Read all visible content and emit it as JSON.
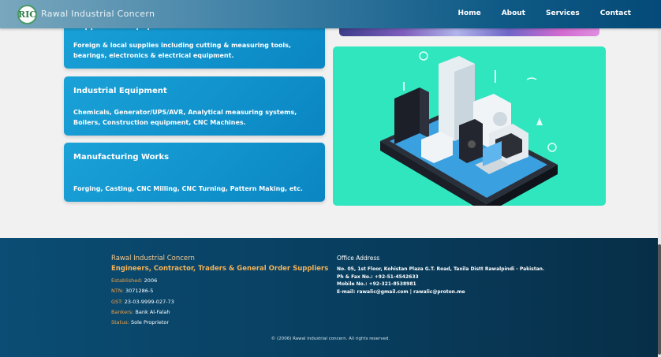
{
  "nav": {
    "brand": "Rawal Industrial Concern",
    "logo_text": "RIC",
    "links": [
      "Home",
      "About",
      "Services",
      "Contact"
    ]
  },
  "services": [
    {
      "title": "Suppliers & Equipment",
      "desc": "Foreign & local supplies including cutting & measuring tools, bearings, electronics & electrical equipment."
    },
    {
      "title": "Industrial Equipment",
      "desc": "Chemicals, Generator/UPS/AVR, Analytical measuring systems, Boilers, Construction equipment, CNC Machines."
    },
    {
      "title": "Manufacturing Works",
      "desc": "Forging, Casting, CNC Milling, CNC Turning, Pattern Making, etc."
    }
  ],
  "footer": {
    "company": "Rawal Industrial Concern",
    "tagline": "Engineers, Contractor, Traders & General Order Suppliers",
    "details": [
      {
        "label": "Established:",
        "value": "2006"
      },
      {
        "label": "NTN:",
        "value": "3071286-5"
      },
      {
        "label": "GST:",
        "value": "23-03-9999-027-73"
      },
      {
        "label": "Bankers:",
        "value": "Bank Al-Falah"
      },
      {
        "label": "Status:",
        "value": "Sole Proprietor"
      }
    ],
    "office_title": "Office Address",
    "office_lines": [
      "No. 05, 1st Floor, Kohistan Plaza G.T. Road, Taxila Distt Rawalpindi - Pakistan.",
      "Ph & Fax No.:   +92-51-4542633",
      "Mobile No.:    +92-321-8538981",
      "E-mail:   rawalic@gmail.com | rawalic@proton.me"
    ],
    "copyright": "© (2006) Rawal industrial concern. All rights reserved."
  },
  "colors": {
    "card": "#0a86c3",
    "footer": "#083f60",
    "accent": "#f3a143",
    "illustration_bg": "#2fe6bf"
  },
  "icons": [
    "company-logo",
    "phone-appliances-illustration"
  ]
}
